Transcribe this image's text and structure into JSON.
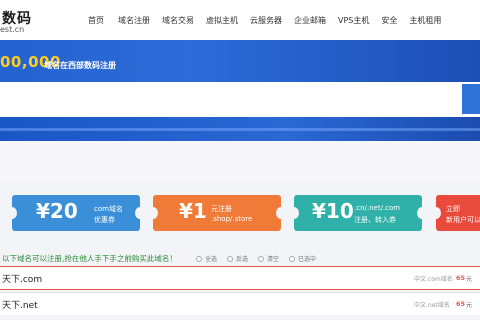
{
  "header": {
    "logo_title": "数码",
    "logo_sub": "est.cn",
    "nav": [
      "首页",
      "域名注册",
      "域名交易",
      "虚拟主机",
      "云服务器",
      "企业邮箱",
      "VPS主机",
      "安全",
      "主机租用"
    ]
  },
  "banner": {
    "count": "00,000",
    "text": "域名在西部数码注册"
  },
  "search": {
    "placeholder": ""
  },
  "coupons": [
    {
      "value": "¥20",
      "line1": "com域名",
      "line2": "优惠券",
      "color": "#3a8fd8"
    },
    {
      "value": "¥1",
      "line1": "元注册",
      "line2": ".shop/.store",
      "color": "#f07a38"
    },
    {
      "value": "¥10",
      "line1": ".cn/.net/.com",
      "line2": "注册、转入券",
      "color": "#2fb0a8"
    },
    {
      "value": "",
      "line1": "立即",
      "line2": "新用户可以",
      "color": "#e84a3c"
    }
  ],
  "results": {
    "headline": "以下域名可以注册,抢在他人手下手之前购买此域名！",
    "filters": [
      "全选",
      "反选",
      "清空",
      "已选中"
    ],
    "rows": [
      {
        "name": "天下.com",
        "status": "中文.com域名",
        "price": "65",
        "unit": "元"
      },
      {
        "name": "天下.net",
        "status": "中文.net域名",
        "price": "65",
        "unit": "元"
      }
    ]
  }
}
